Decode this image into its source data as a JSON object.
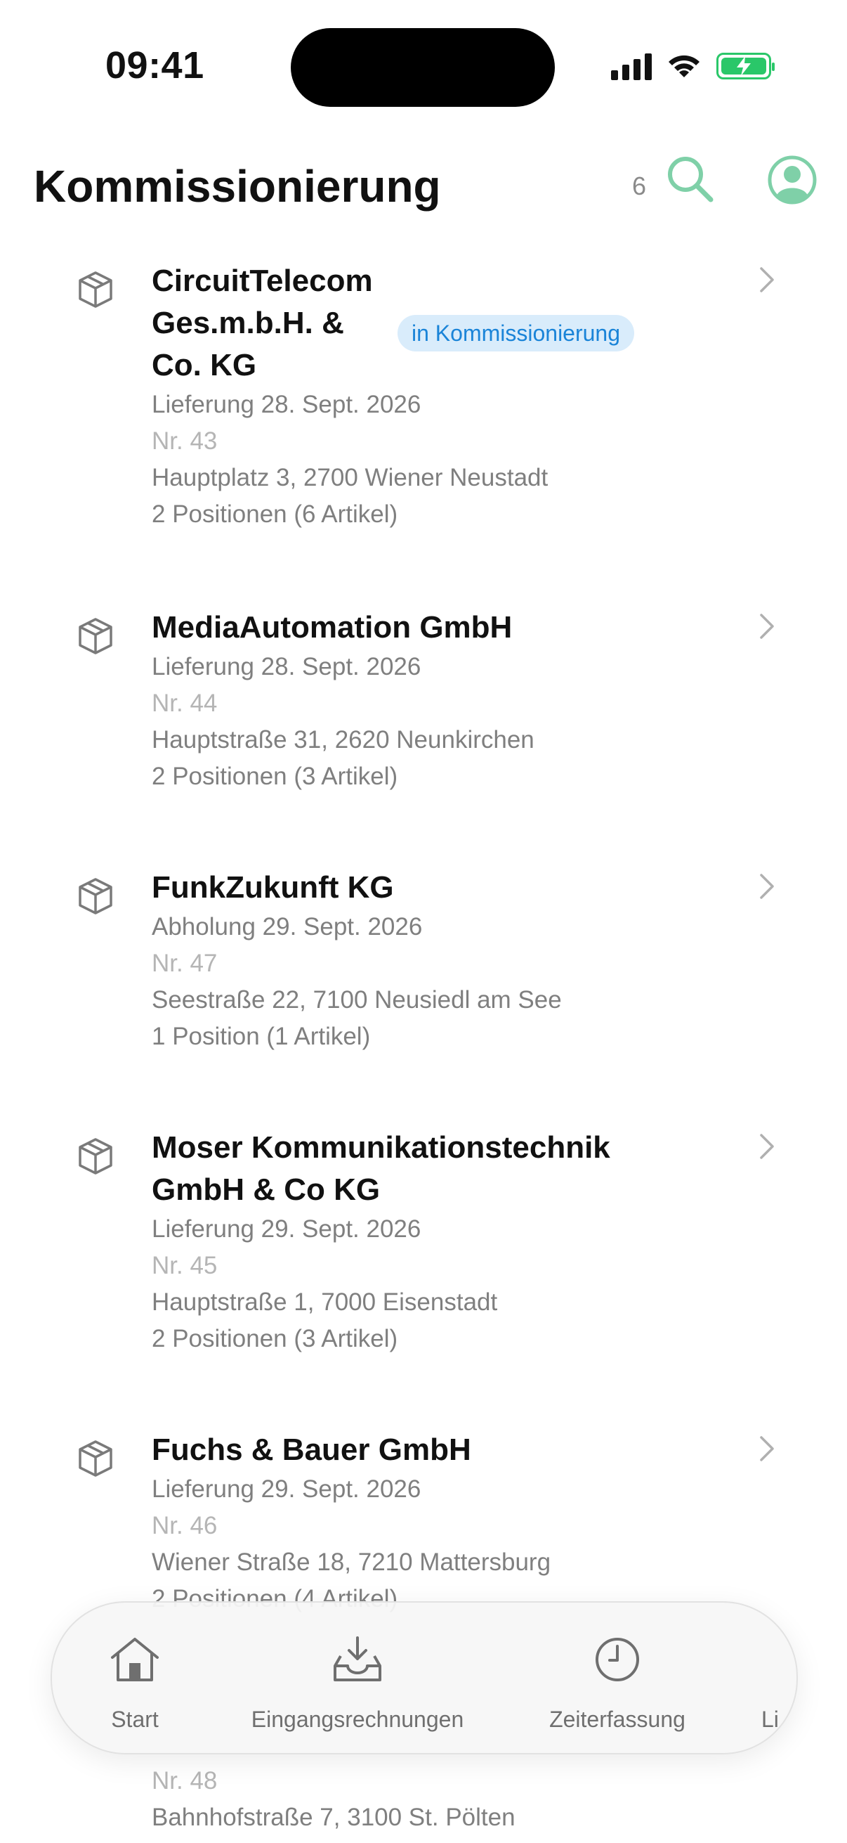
{
  "status_bar": {
    "time": "09:41"
  },
  "header": {
    "title": "Kommissionierung",
    "search_count": "6"
  },
  "items": [
    {
      "name": "CircuitTelecom Ges.m.b.H. & Co. KG",
      "badge": "in Kommissionierung",
      "date": "Lieferung 28. Sept. 2026",
      "nr": "Nr. 43",
      "address": "Hauptplatz 3, 2700 Wiener Neustadt",
      "positions": "2 Positionen (6 Artikel)"
    },
    {
      "name": "MediaAutomation GmbH",
      "date": "Lieferung 28. Sept. 2026",
      "nr": "Nr. 44",
      "address": "Hauptstraße 31, 2620 Neunkirchen",
      "positions": "2 Positionen (3 Artikel)"
    },
    {
      "name": "FunkZukunft KG",
      "date": "Abholung 29. Sept. 2026",
      "nr": "Nr. 47",
      "address": "Seestraße 22, 7100 Neusiedl am See",
      "positions": "1 Position (1 Artikel)"
    },
    {
      "name": "Moser Kommunikationstechnik GmbH & Co KG",
      "date": "Lieferung 29. Sept. 2026",
      "nr": "Nr. 45",
      "address": "Hauptstraße 1, 7000 Eisenstadt",
      "positions": "2 Positionen (3 Artikel)"
    },
    {
      "name": "Fuchs & Bauer GmbH",
      "date": "Lieferung 29. Sept. 2026",
      "nr": "Nr. 46",
      "address": "Wiener Straße 18, 7210 Mattersburg",
      "positions": "2 Positionen (4 Artikel)"
    },
    {
      "nr": "Nr. 48",
      "address": "Bahnhofstraße 7, 3100 St. Pölten"
    }
  ],
  "tab_bar": {
    "tabs": [
      {
        "label": "Start",
        "icon": "home-icon"
      },
      {
        "label": "Eingangsrechnungen",
        "icon": "inbox-download-icon"
      },
      {
        "label": "Zeiterfassung",
        "icon": "clock-icon"
      },
      {
        "label": "Li",
        "icon": ""
      }
    ]
  },
  "colors": {
    "accent": "#7fd0a8",
    "badge_bg": "#d9ecfb",
    "badge_text": "#1a84d8",
    "battery": "#2ac769"
  }
}
